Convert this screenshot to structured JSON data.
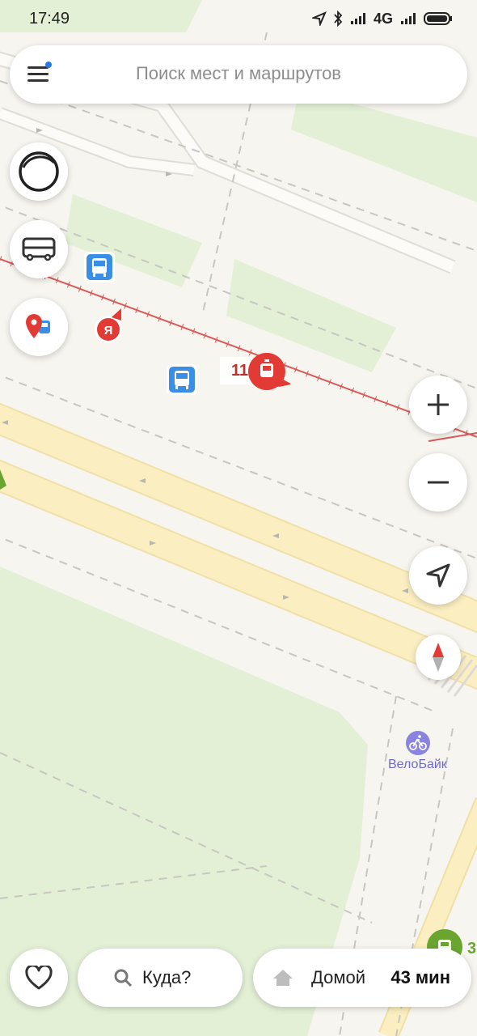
{
  "status_bar": {
    "time": "17:49",
    "network": "4G",
    "icons": [
      "location-arrow-icon",
      "bluetooth-icon",
      "signal-icon",
      "signal-icon",
      "battery-icon"
    ]
  },
  "search": {
    "placeholder": "Поиск мест и маршрутов",
    "menu_icon": "hamburger-menu-icon"
  },
  "map": {
    "route_label": "11",
    "poi_label": "ВелоБайк",
    "yandex_badge": "Я",
    "green_stop_label": "3",
    "colors": {
      "background": "#f7f5ef",
      "park": "#e3f0d6",
      "road": "#fbeec0",
      "tram_line": "#d65a5a",
      "transit_blue": "#3a8ee6",
      "marker_red": "#e23b35",
      "velobike": "#8a83df",
      "green_stop": "#6aa52f"
    }
  },
  "left_controls": {
    "alice_icon": "alice-ring-icon",
    "transport_icon": "bus-icon",
    "places_icon": "map-pin-transport-icon"
  },
  "right_controls": {
    "zoom_in": "+",
    "zoom_out": "−",
    "location_icon": "navigation-arrow-icon",
    "compass_icon": "compass-icon"
  },
  "bottom": {
    "favorites_icon": "heart-icon",
    "where_label": "Куда?",
    "home_label": "Домой",
    "home_time": "43 мин"
  }
}
